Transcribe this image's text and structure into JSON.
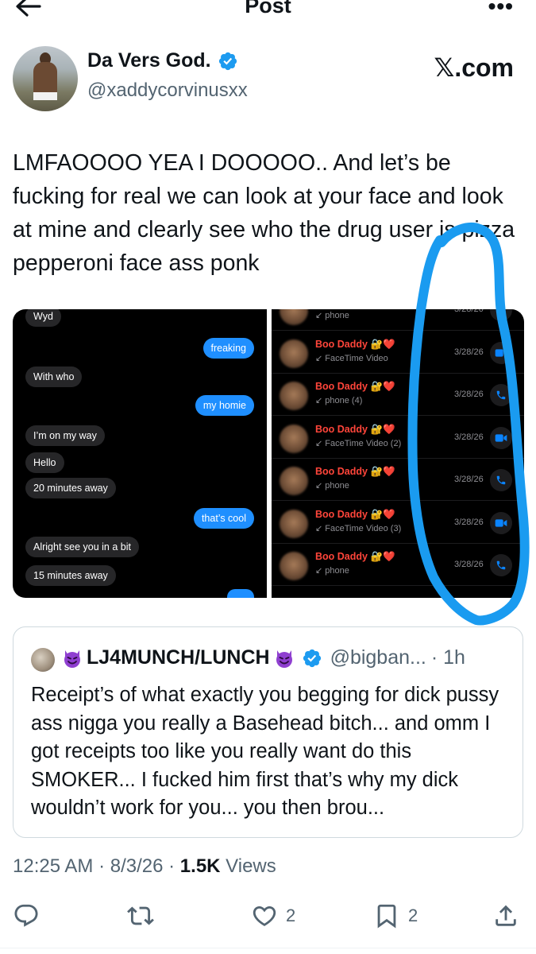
{
  "topbar": {
    "title": "Post"
  },
  "post": {
    "author_name": "Da Vers God.",
    "author_handle": "@xaddycorvinusxx",
    "watermark": "𝕏.com",
    "text": "LMFAOOOO YEA I DOOOOO.. And let’s be fucking for real we can look at your face and look at mine and clearly see who the drug user is pizza pepperoni face ass ponk",
    "timestamp": "12:25 AM · 8/3/26 · ",
    "views_count": "1.5K",
    "views_label": " Views"
  },
  "media": {
    "messages": [
      {
        "text": "Wyd",
        "dir": "in"
      },
      {
        "text": "freaking",
        "dir": "out"
      },
      {
        "text": "With who",
        "dir": "in"
      },
      {
        "text": "my homie",
        "dir": "out"
      },
      {
        "text": "I’m on my way",
        "dir": "in"
      },
      {
        "text": "Hello",
        "dir": "in"
      },
      {
        "text": "20 minutes away",
        "dir": "in"
      },
      {
        "text": "that’s cool",
        "dir": "out"
      },
      {
        "text": "Alright see you in a bit",
        "dir": "in"
      },
      {
        "text": "15 minutes away",
        "dir": "in"
      }
    ],
    "calls": [
      {
        "name": "",
        "type": "↙ phone",
        "date": "3/28/26",
        "icon": "phone-icon"
      },
      {
        "name": "Boo Daddy 🔐❤️",
        "type": "↙ FaceTime Video",
        "date": "3/28/26",
        "icon": "video-icon"
      },
      {
        "name": "Boo Daddy 🔐❤️",
        "type": "↙ phone (4)",
        "date": "3/28/26",
        "icon": "phone-icon"
      },
      {
        "name": "Boo Daddy 🔐❤️",
        "type": "↙ FaceTime Video (2)",
        "date": "3/28/26",
        "icon": "video-icon"
      },
      {
        "name": "Boo Daddy 🔐❤️",
        "type": "↙ phone",
        "date": "3/28/26",
        "icon": "phone-icon"
      },
      {
        "name": "Boo Daddy 🔐❤️",
        "type": "↙ FaceTime Video (3)",
        "date": "3/28/26",
        "icon": "video-icon"
      },
      {
        "name": "Boo Daddy 🔐❤️",
        "type": "↙ phone",
        "date": "3/28/26",
        "icon": "phone-icon"
      }
    ]
  },
  "quote": {
    "name": "LJ4MUNCH/LUNCH",
    "handle": "@bigban...",
    "time": "· 1h",
    "text": "Receipt’s of what exactly you begging for dick pussy ass nigga you really a Basehead bitch... and omm I got receipts too like you really want do this SMOKER... I fucked him first that’s why my dick wouldn’t work for you... you then brou..."
  },
  "actions": {
    "likes": "2",
    "bookmarks": "2"
  },
  "colors": {
    "accent": "#1d9bf0",
    "annotation": "#1a9bf0",
    "imessage_blue": "#1f8fff",
    "missed_call_red": "#ff453a"
  }
}
